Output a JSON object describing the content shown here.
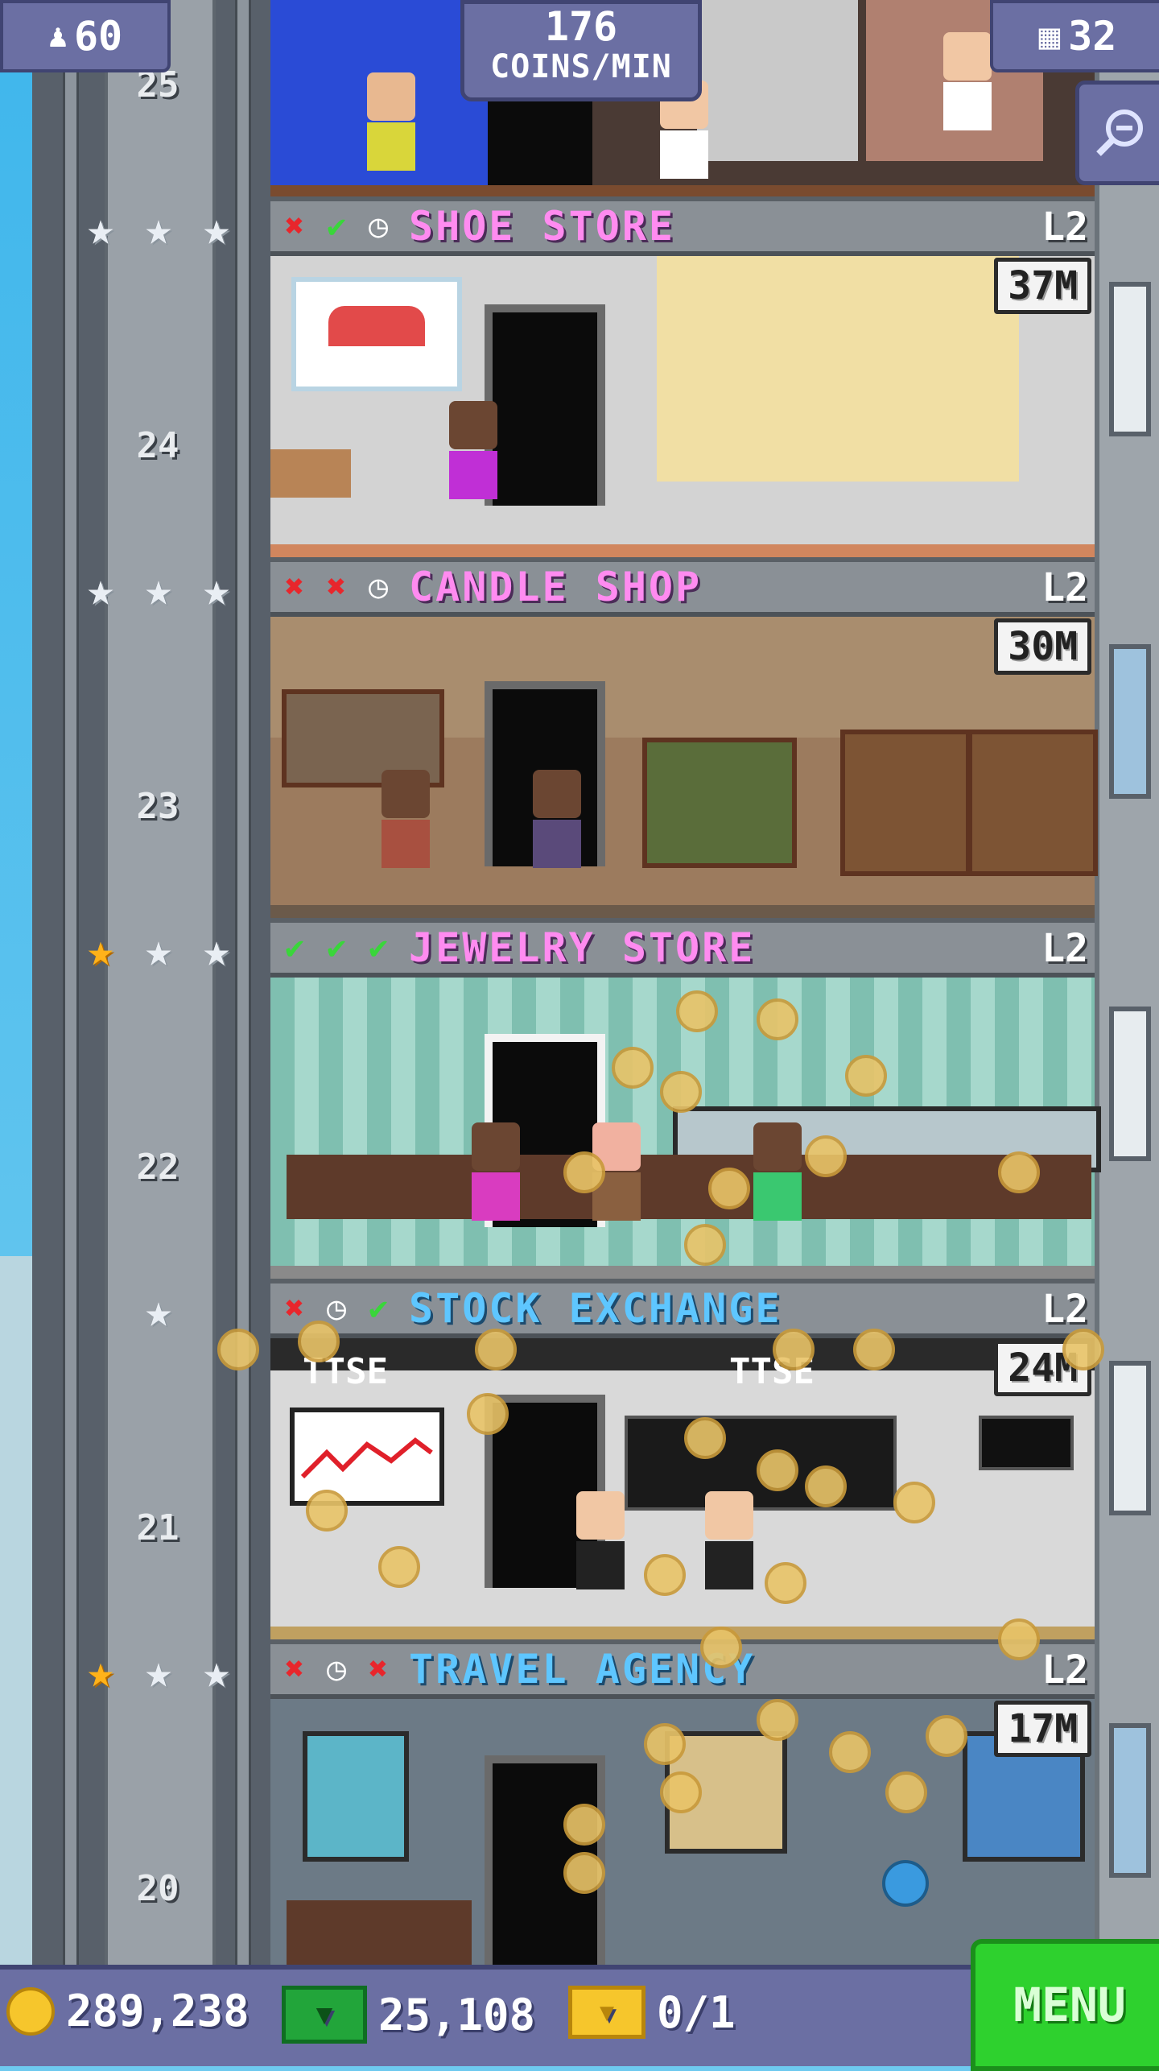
{
  "top_bar": {
    "population_icon": "person-icon",
    "population": "60",
    "coins_per_min_value": "176",
    "coins_per_min_unit": "COINS/MIN",
    "floors_icon": "building-icon",
    "floors": "32",
    "zoom_icon": "zoom-out-icon"
  },
  "floors": [
    {
      "number": "25"
    },
    {
      "number": "24",
      "name": "SHOE STORE",
      "level": "L2",
      "stock": "37M",
      "status": [
        "x",
        "check",
        "clock"
      ],
      "stars": [
        "silver",
        "silver",
        "silver"
      ]
    },
    {
      "number": "23",
      "name": "CANDLE SHOP",
      "level": "L2",
      "stock": "30M",
      "status": [
        "x",
        "x",
        "clock"
      ],
      "stars": [
        "silver",
        "silver",
        "silver"
      ]
    },
    {
      "number": "22",
      "name": "JEWELRY STORE",
      "level": "L2",
      "stock": "",
      "status": [
        "check",
        "check",
        "check"
      ],
      "stars": [
        "gold",
        "silver",
        "silver"
      ]
    },
    {
      "number": "21",
      "name": "STOCK EXCHANGE",
      "level": "L2",
      "stock": "24M",
      "status": [
        "x",
        "clock",
        "check"
      ],
      "stars": [
        "silver"
      ]
    },
    {
      "number": "20",
      "name": "TRAVEL AGENCY",
      "level": "L2",
      "stock": "17M",
      "status": [
        "x",
        "clock",
        "x"
      ],
      "stars": [
        "gold",
        "silver",
        "silver"
      ]
    }
  ],
  "signs": {
    "stock_left": "TTSE",
    "stock_right": "TTSE"
  },
  "bottom_bar": {
    "coins": "289,238",
    "bux": "25,108",
    "tickets": "0/1",
    "menu_label": "MENU"
  },
  "colors": {
    "accent": "#6b6fa3",
    "menu": "#2ed12e",
    "store_pink": "#ff8bf0",
    "store_blue": "#5ec6ff"
  }
}
